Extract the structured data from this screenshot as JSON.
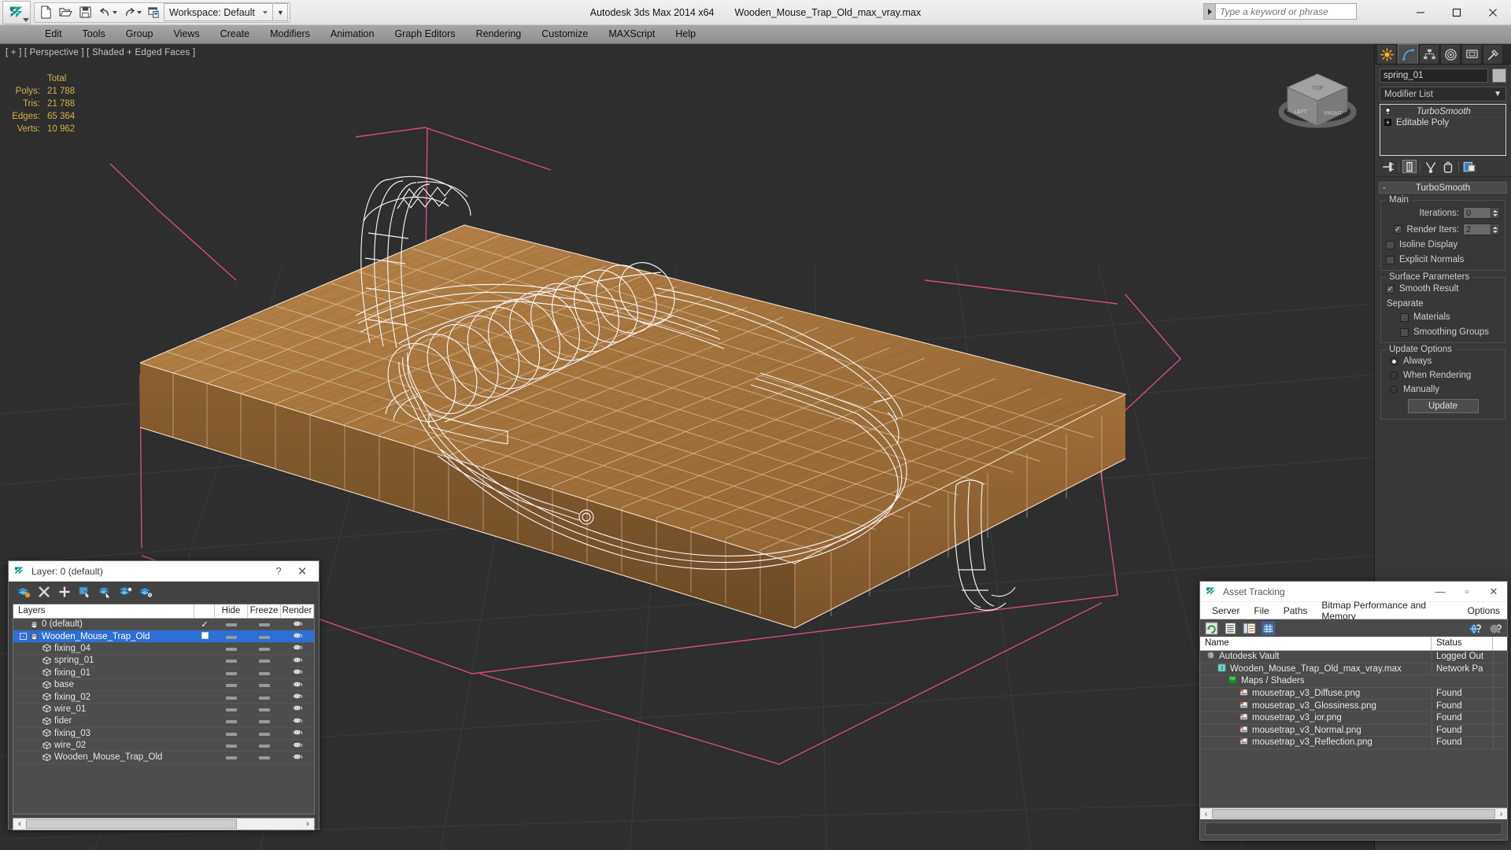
{
  "titlebar": {
    "app_title": "Autodesk 3ds Max  2014 x64",
    "file_title": "Wooden_Mouse_Trap_Old_max_vray.max",
    "workspace": "Workspace: Default",
    "search_placeholder": "Type a keyword or phrase",
    "quick_access": [
      "new-file-icon",
      "open-file-icon",
      "save-file-icon",
      "undo-icon",
      "redo-icon",
      "project-folder-icon"
    ],
    "window_buttons": [
      "minimize",
      "maximize",
      "close"
    ]
  },
  "menubar": {
    "items": [
      "Edit",
      "Tools",
      "Group",
      "Views",
      "Create",
      "Modifiers",
      "Animation",
      "Graph Editors",
      "Rendering",
      "Customize",
      "MAXScript",
      "Help"
    ]
  },
  "viewport": {
    "label": "[ + ] [ Perspective ] [ Shaded + Edged Faces ]",
    "stats": {
      "header": "Total",
      "rows": [
        {
          "label": "Polys:",
          "value": "21 788"
        },
        {
          "label": "Tris:",
          "value": "21 788"
        },
        {
          "label": "Edges:",
          "value": "65 364"
        },
        {
          "label": "Verts:",
          "value": "10 962"
        }
      ]
    },
    "viewcube_faces": {
      "top": "TOP",
      "left": "LEFT",
      "front": "FRONT"
    }
  },
  "command_panel": {
    "tabs": [
      {
        "name": "create",
        "icon": "create-star-icon",
        "active": false
      },
      {
        "name": "modify",
        "icon": "modify-curve-icon",
        "active": true
      },
      {
        "name": "hierarchy",
        "icon": "hierarchy-icon",
        "active": false
      },
      {
        "name": "motion",
        "icon": "motion-wheel-icon",
        "active": false
      },
      {
        "name": "display",
        "icon": "display-monitor-icon",
        "active": false
      },
      {
        "name": "utilities",
        "icon": "utilities-hammer-icon",
        "active": false
      }
    ],
    "object_name": "spring_01",
    "modifier_list_label": "Modifier List",
    "stack": [
      {
        "label": "TurboSmooth",
        "italic": true,
        "icon": "lightbulb-icon"
      },
      {
        "label": "Editable Poly",
        "italic": false,
        "icon": "plus-box-icon"
      }
    ],
    "stack_tools": [
      "pin-stack-icon",
      "show-end-result-icon",
      "make-unique-icon",
      "remove-modifier-icon",
      "configure-sets-icon"
    ],
    "rollout": {
      "title": "TurboSmooth",
      "main_group": "Main",
      "iterations_label": "Iterations:",
      "iterations_value": "0",
      "render_iters_label": "Render Iters:",
      "render_iters_value": "2",
      "render_iters_checked": true,
      "isoline_display_label": "Isoline Display",
      "isoline_display_checked": false,
      "explicit_normals_label": "Explicit Normals",
      "explicit_normals_checked": false,
      "surface_group": "Surface Parameters",
      "smooth_result_label": "Smooth Result",
      "smooth_result_checked": true,
      "separate_label": "Separate",
      "materials_label": "Materials",
      "materials_checked": false,
      "smoothing_groups_label": "Smoothing Groups",
      "smoothing_groups_checked": false,
      "update_group": "Update Options",
      "update_options": [
        {
          "label": "Always",
          "selected": true
        },
        {
          "label": "When Rendering",
          "selected": false
        },
        {
          "label": "Manually",
          "selected": false
        }
      ],
      "update_button": "Update"
    }
  },
  "layer_dialog": {
    "title": "Layer: 0 (default)",
    "help_btn": "?",
    "close_btn": "✕",
    "toolbar": [
      "new-layer-icon",
      "delete-layer-icon",
      "add-layer-icon",
      "select-objects-icon",
      "select-highlighted-icon",
      "highlight-selected-icon",
      "layer-properties-icon"
    ],
    "columns": {
      "name": "Layers",
      "hide": "Hide",
      "freeze": "Freeze",
      "render": "Render"
    },
    "rows": [
      {
        "name": "0 (default)",
        "indent": 0,
        "icon": "layer-icon",
        "selected": false,
        "check": "✓",
        "expander": ""
      },
      {
        "name": "Wooden_Mouse_Trap_Old",
        "indent": 0,
        "icon": "layer-icon",
        "selected": true,
        "check": "box",
        "expander": "-"
      },
      {
        "name": "fixing_04",
        "indent": 1,
        "icon": "object-icon",
        "selected": false,
        "check": "",
        "expander": ""
      },
      {
        "name": "spring_01",
        "indent": 1,
        "icon": "object-icon",
        "selected": false,
        "check": "",
        "expander": ""
      },
      {
        "name": "fixing_01",
        "indent": 1,
        "icon": "object-icon",
        "selected": false,
        "check": "",
        "expander": ""
      },
      {
        "name": "base",
        "indent": 1,
        "icon": "object-icon",
        "selected": false,
        "check": "",
        "expander": ""
      },
      {
        "name": "fixing_02",
        "indent": 1,
        "icon": "object-icon",
        "selected": false,
        "check": "",
        "expander": ""
      },
      {
        "name": "wire_01",
        "indent": 1,
        "icon": "object-icon",
        "selected": false,
        "check": "",
        "expander": ""
      },
      {
        "name": "fider",
        "indent": 1,
        "icon": "object-icon",
        "selected": false,
        "check": "",
        "expander": ""
      },
      {
        "name": "fixing_03",
        "indent": 1,
        "icon": "object-icon",
        "selected": false,
        "check": "",
        "expander": ""
      },
      {
        "name": "wire_02",
        "indent": 1,
        "icon": "object-icon",
        "selected": false,
        "check": "",
        "expander": ""
      },
      {
        "name": "Wooden_Mouse_Trap_Old",
        "indent": 1,
        "icon": "object-icon",
        "selected": false,
        "check": "",
        "expander": ""
      }
    ]
  },
  "asset_tracking": {
    "title": "Asset Tracking",
    "menu": [
      "Server",
      "File",
      "Paths",
      "Bitmap Performance and Memory",
      "Options"
    ],
    "toolbar": [
      "refresh-icon",
      "list-view-icon",
      "detail-view-icon",
      "grid-view-icon"
    ],
    "toolbar_right": [
      "help-globe-icon",
      "help-icon"
    ],
    "columns": {
      "name": "Name",
      "status": "Status"
    },
    "rows": [
      {
        "name": "Autodesk Vault",
        "status": "Logged Out",
        "indent": 0,
        "icon": "vault-icon"
      },
      {
        "name": "Wooden_Mouse_Trap_Old_max_vray.max",
        "status": "Network Pa",
        "indent": 1,
        "icon": "max-file-icon"
      },
      {
        "name": "Maps / Shaders",
        "status": "",
        "indent": 2,
        "icon": "maps-icon"
      },
      {
        "name": "mousetrap_v3_Diffuse.png",
        "status": "Found",
        "indent": 3,
        "icon": "bitmap-icon"
      },
      {
        "name": "mousetrap_v3_Glossiness.png",
        "status": "Found",
        "indent": 3,
        "icon": "bitmap-icon"
      },
      {
        "name": "mousetrap_v3_ior.png",
        "status": "Found",
        "indent": 3,
        "icon": "bitmap-icon"
      },
      {
        "name": "mousetrap_v3_Normal.png",
        "status": "Found",
        "indent": 3,
        "icon": "bitmap-icon"
      },
      {
        "name": "mousetrap_v3_Reflection.png",
        "status": "Found",
        "indent": 3,
        "icon": "bitmap-icon"
      }
    ],
    "window_buttons": [
      "minimize",
      "maximize",
      "close"
    ]
  },
  "colors": {
    "accent_blue": "#2c6fd6",
    "stats_gold": "#d4b24a",
    "panel_gray": "#383838",
    "viewport_bg": "#2e2e2e",
    "wood": "#a87b45",
    "wire_white": "#f2f2f2",
    "gizmo_pink": "#e0508f"
  }
}
